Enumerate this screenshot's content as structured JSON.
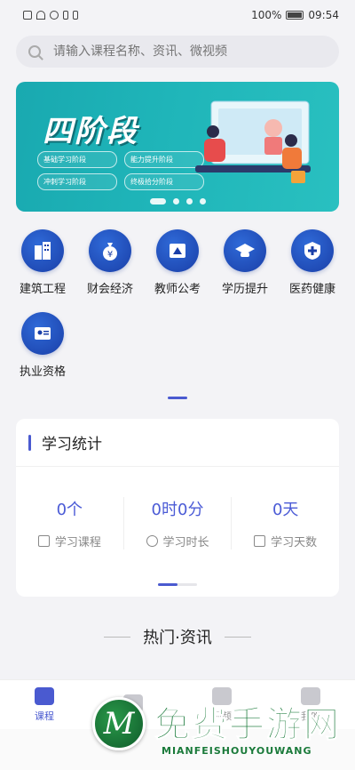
{
  "status_bar": {
    "battery": "100%",
    "time": "09:54"
  },
  "search": {
    "placeholder": "请输入课程名称、资讯、微视频"
  },
  "banner": {
    "title": "四阶段",
    "tags": [
      "基础学习阶段",
      "能力提升阶段",
      "冲刺学习阶段",
      "终极拾分阶段"
    ]
  },
  "categories": [
    {
      "label": "建筑工程",
      "icon": "building-icon"
    },
    {
      "label": "财会经济",
      "icon": "money-bag-icon"
    },
    {
      "label": "教师公考",
      "icon": "teacher-icon"
    },
    {
      "label": "学历提升",
      "icon": "graduation-icon"
    },
    {
      "label": "医药健康",
      "icon": "medical-cross-icon"
    },
    {
      "label": "执业资格",
      "icon": "certificate-icon"
    }
  ],
  "stats": {
    "title": "学习统计",
    "items": [
      {
        "value": "0个",
        "label": "学习课程",
        "icon": "course-icon"
      },
      {
        "value": "0时0分",
        "label": "学习时长",
        "icon": "clock-icon"
      },
      {
        "value": "0天",
        "label": "学习天数",
        "icon": "calendar-icon"
      }
    ]
  },
  "hot_section": {
    "title": "热门·资讯"
  },
  "tabs": [
    {
      "label": "课程",
      "active": true
    },
    {
      "label": "",
      "active": false
    },
    {
      "label": "视频",
      "active": false
    },
    {
      "label": "我的",
      "active": false
    }
  ],
  "watermark": {
    "text": "免费手游网",
    "sub": "MIANFEISHOUYOUWANG"
  },
  "colors": {
    "accent": "#4a5ad0",
    "banner": "#1fb5b9",
    "icon_blue": "#1a3fa8"
  }
}
